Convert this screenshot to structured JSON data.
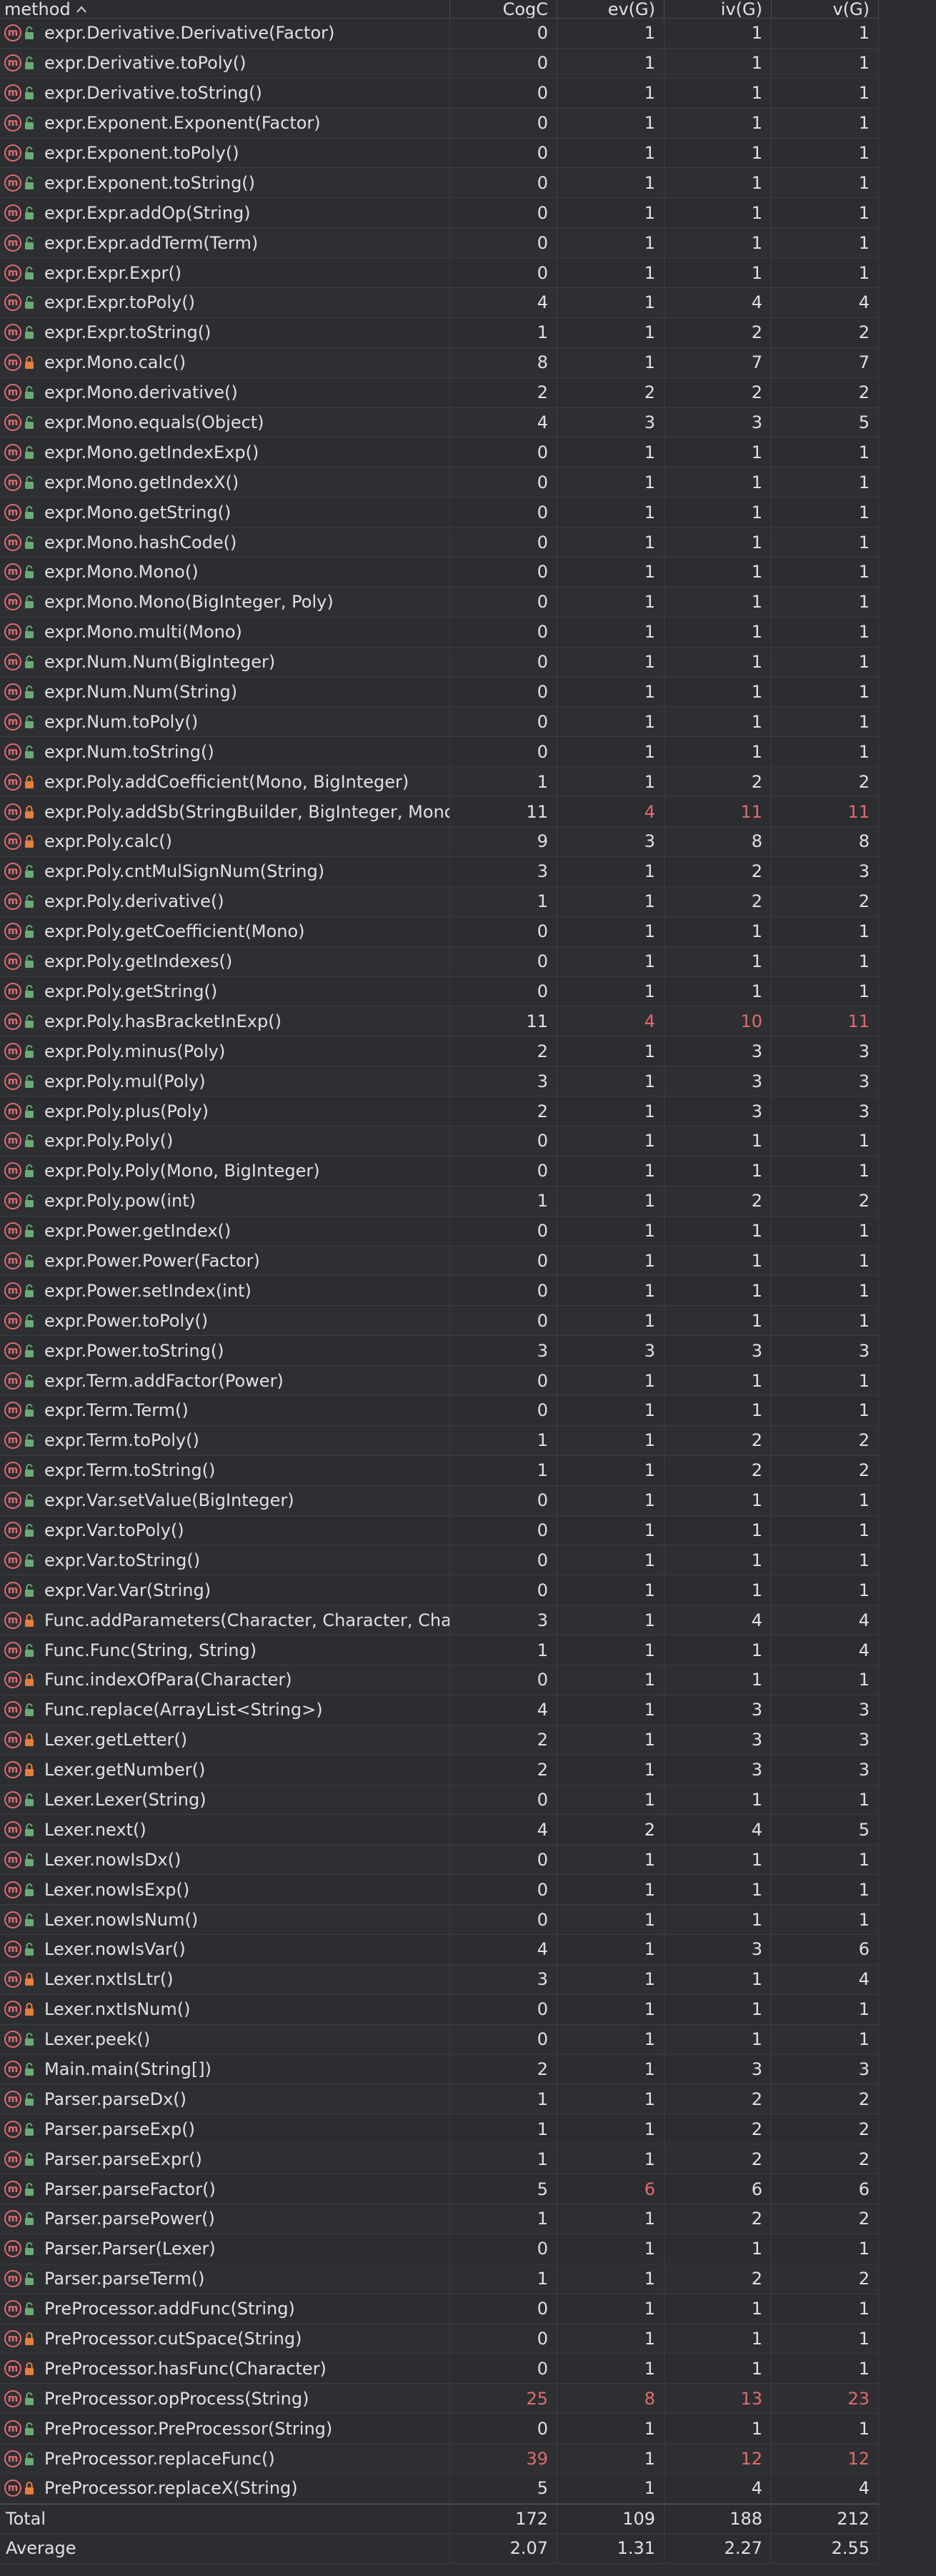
{
  "header": {
    "method": "method",
    "sort_icon": "chevron-up-icon",
    "cogc": "CogC",
    "evg": "ev(G)",
    "ivg": "iv(G)",
    "vg": "v(G)"
  },
  "colors": {
    "background": "#2b2d30",
    "text": "#dfe1e5",
    "warning": "#e06c6c",
    "method_icon": "#e06c75",
    "public_lock": "#6aab73",
    "private_lock": "#e67e3c"
  },
  "rows": [
    {
      "name": "expr.Derivative.Derivative(Factor)",
      "access": "public",
      "cogc": "0",
      "evg": "1",
      "ivg": "1",
      "vg": "1"
    },
    {
      "name": "expr.Derivative.toPoly()",
      "access": "public",
      "cogc": "0",
      "evg": "1",
      "ivg": "1",
      "vg": "1"
    },
    {
      "name": "expr.Derivative.toString()",
      "access": "public",
      "cogc": "0",
      "evg": "1",
      "ivg": "1",
      "vg": "1"
    },
    {
      "name": "expr.Exponent.Exponent(Factor)",
      "access": "public",
      "cogc": "0",
      "evg": "1",
      "ivg": "1",
      "vg": "1"
    },
    {
      "name": "expr.Exponent.toPoly()",
      "access": "public",
      "cogc": "0",
      "evg": "1",
      "ivg": "1",
      "vg": "1"
    },
    {
      "name": "expr.Exponent.toString()",
      "access": "public",
      "cogc": "0",
      "evg": "1",
      "ivg": "1",
      "vg": "1"
    },
    {
      "name": "expr.Expr.addOp(String)",
      "access": "public",
      "cogc": "0",
      "evg": "1",
      "ivg": "1",
      "vg": "1"
    },
    {
      "name": "expr.Expr.addTerm(Term)",
      "access": "public",
      "cogc": "0",
      "evg": "1",
      "ivg": "1",
      "vg": "1"
    },
    {
      "name": "expr.Expr.Expr()",
      "access": "public",
      "cogc": "0",
      "evg": "1",
      "ivg": "1",
      "vg": "1"
    },
    {
      "name": "expr.Expr.toPoly()",
      "access": "public",
      "cogc": "4",
      "evg": "1",
      "ivg": "4",
      "vg": "4"
    },
    {
      "name": "expr.Expr.toString()",
      "access": "public",
      "cogc": "1",
      "evg": "1",
      "ivg": "2",
      "vg": "2"
    },
    {
      "name": "expr.Mono.calc()",
      "access": "private",
      "cogc": "8",
      "evg": "1",
      "ivg": "7",
      "vg": "7"
    },
    {
      "name": "expr.Mono.derivative()",
      "access": "public",
      "cogc": "2",
      "evg": "2",
      "ivg": "2",
      "vg": "2"
    },
    {
      "name": "expr.Mono.equals(Object)",
      "access": "public",
      "cogc": "4",
      "evg": "3",
      "ivg": "3",
      "vg": "5"
    },
    {
      "name": "expr.Mono.getIndexExp()",
      "access": "public",
      "cogc": "0",
      "evg": "1",
      "ivg": "1",
      "vg": "1"
    },
    {
      "name": "expr.Mono.getIndexX()",
      "access": "public",
      "cogc": "0",
      "evg": "1",
      "ivg": "1",
      "vg": "1"
    },
    {
      "name": "expr.Mono.getString()",
      "access": "public",
      "cogc": "0",
      "evg": "1",
      "ivg": "1",
      "vg": "1"
    },
    {
      "name": "expr.Mono.hashCode()",
      "access": "public",
      "cogc": "0",
      "evg": "1",
      "ivg": "1",
      "vg": "1"
    },
    {
      "name": "expr.Mono.Mono()",
      "access": "public",
      "cogc": "0",
      "evg": "1",
      "ivg": "1",
      "vg": "1"
    },
    {
      "name": "expr.Mono.Mono(BigInteger, Poly)",
      "access": "public",
      "cogc": "0",
      "evg": "1",
      "ivg": "1",
      "vg": "1"
    },
    {
      "name": "expr.Mono.multi(Mono)",
      "access": "public",
      "cogc": "0",
      "evg": "1",
      "ivg": "1",
      "vg": "1"
    },
    {
      "name": "expr.Num.Num(BigInteger)",
      "access": "public",
      "cogc": "0",
      "evg": "1",
      "ivg": "1",
      "vg": "1"
    },
    {
      "name": "expr.Num.Num(String)",
      "access": "public",
      "cogc": "0",
      "evg": "1",
      "ivg": "1",
      "vg": "1"
    },
    {
      "name": "expr.Num.toPoly()",
      "access": "public",
      "cogc": "0",
      "evg": "1",
      "ivg": "1",
      "vg": "1"
    },
    {
      "name": "expr.Num.toString()",
      "access": "public",
      "cogc": "0",
      "evg": "1",
      "ivg": "1",
      "vg": "1"
    },
    {
      "name": "expr.Poly.addCoefficient(Mono, BigInteger)",
      "access": "private",
      "cogc": "1",
      "evg": "1",
      "ivg": "2",
      "vg": "2"
    },
    {
      "name": "expr.Poly.addSb(StringBuilder, BigInteger, Mono",
      "access": "private",
      "cogc": "11",
      "evg": "4",
      "ivg": "11",
      "vg": "11",
      "warn": [
        "evg",
        "ivg",
        "vg"
      ]
    },
    {
      "name": "expr.Poly.calc()",
      "access": "private",
      "cogc": "9",
      "evg": "3",
      "ivg": "8",
      "vg": "8"
    },
    {
      "name": "expr.Poly.cntMulSignNum(String)",
      "access": "public",
      "cogc": "3",
      "evg": "1",
      "ivg": "2",
      "vg": "3"
    },
    {
      "name": "expr.Poly.derivative()",
      "access": "public",
      "cogc": "1",
      "evg": "1",
      "ivg": "2",
      "vg": "2"
    },
    {
      "name": "expr.Poly.getCoefficient(Mono)",
      "access": "public",
      "cogc": "0",
      "evg": "1",
      "ivg": "1",
      "vg": "1"
    },
    {
      "name": "expr.Poly.getIndexes()",
      "access": "public",
      "cogc": "0",
      "evg": "1",
      "ivg": "1",
      "vg": "1"
    },
    {
      "name": "expr.Poly.getString()",
      "access": "public",
      "cogc": "0",
      "evg": "1",
      "ivg": "1",
      "vg": "1"
    },
    {
      "name": "expr.Poly.hasBracketInExp()",
      "access": "public",
      "cogc": "11",
      "evg": "4",
      "ivg": "10",
      "vg": "11",
      "warn": [
        "evg",
        "ivg",
        "vg"
      ]
    },
    {
      "name": "expr.Poly.minus(Poly)",
      "access": "public",
      "cogc": "2",
      "evg": "1",
      "ivg": "3",
      "vg": "3"
    },
    {
      "name": "expr.Poly.mul(Poly)",
      "access": "public",
      "cogc": "3",
      "evg": "1",
      "ivg": "3",
      "vg": "3"
    },
    {
      "name": "expr.Poly.plus(Poly)",
      "access": "public",
      "cogc": "2",
      "evg": "1",
      "ivg": "3",
      "vg": "3"
    },
    {
      "name": "expr.Poly.Poly()",
      "access": "public",
      "cogc": "0",
      "evg": "1",
      "ivg": "1",
      "vg": "1"
    },
    {
      "name": "expr.Poly.Poly(Mono, BigInteger)",
      "access": "public",
      "cogc": "0",
      "evg": "1",
      "ivg": "1",
      "vg": "1"
    },
    {
      "name": "expr.Poly.pow(int)",
      "access": "public",
      "cogc": "1",
      "evg": "1",
      "ivg": "2",
      "vg": "2"
    },
    {
      "name": "expr.Power.getIndex()",
      "access": "public",
      "cogc": "0",
      "evg": "1",
      "ivg": "1",
      "vg": "1"
    },
    {
      "name": "expr.Power.Power(Factor)",
      "access": "public",
      "cogc": "0",
      "evg": "1",
      "ivg": "1",
      "vg": "1"
    },
    {
      "name": "expr.Power.setIndex(int)",
      "access": "public",
      "cogc": "0",
      "evg": "1",
      "ivg": "1",
      "vg": "1"
    },
    {
      "name": "expr.Power.toPoly()",
      "access": "public",
      "cogc": "0",
      "evg": "1",
      "ivg": "1",
      "vg": "1"
    },
    {
      "name": "expr.Power.toString()",
      "access": "public",
      "cogc": "3",
      "evg": "3",
      "ivg": "3",
      "vg": "3"
    },
    {
      "name": "expr.Term.addFactor(Power)",
      "access": "public",
      "cogc": "0",
      "evg": "1",
      "ivg": "1",
      "vg": "1"
    },
    {
      "name": "expr.Term.Term()",
      "access": "public",
      "cogc": "0",
      "evg": "1",
      "ivg": "1",
      "vg": "1"
    },
    {
      "name": "expr.Term.toPoly()",
      "access": "public",
      "cogc": "1",
      "evg": "1",
      "ivg": "2",
      "vg": "2"
    },
    {
      "name": "expr.Term.toString()",
      "access": "public",
      "cogc": "1",
      "evg": "1",
      "ivg": "2",
      "vg": "2"
    },
    {
      "name": "expr.Var.setValue(BigInteger)",
      "access": "public",
      "cogc": "0",
      "evg": "1",
      "ivg": "1",
      "vg": "1"
    },
    {
      "name": "expr.Var.toPoly()",
      "access": "public",
      "cogc": "0",
      "evg": "1",
      "ivg": "1",
      "vg": "1"
    },
    {
      "name": "expr.Var.toString()",
      "access": "public",
      "cogc": "0",
      "evg": "1",
      "ivg": "1",
      "vg": "1"
    },
    {
      "name": "expr.Var.Var(String)",
      "access": "public",
      "cogc": "0",
      "evg": "1",
      "ivg": "1",
      "vg": "1"
    },
    {
      "name": "Func.addParameters(Character, Character, Char",
      "access": "private",
      "cogc": "3",
      "evg": "1",
      "ivg": "4",
      "vg": "4"
    },
    {
      "name": "Func.Func(String, String)",
      "access": "public",
      "cogc": "1",
      "evg": "1",
      "ivg": "1",
      "vg": "4"
    },
    {
      "name": "Func.indexOfPara(Character)",
      "access": "private",
      "cogc": "0",
      "evg": "1",
      "ivg": "1",
      "vg": "1"
    },
    {
      "name": "Func.replace(ArrayList<String>)",
      "access": "public",
      "cogc": "4",
      "evg": "1",
      "ivg": "3",
      "vg": "3"
    },
    {
      "name": "Lexer.getLetter()",
      "access": "private",
      "cogc": "2",
      "evg": "1",
      "ivg": "3",
      "vg": "3"
    },
    {
      "name": "Lexer.getNumber()",
      "access": "private",
      "cogc": "2",
      "evg": "1",
      "ivg": "3",
      "vg": "3"
    },
    {
      "name": "Lexer.Lexer(String)",
      "access": "public",
      "cogc": "0",
      "evg": "1",
      "ivg": "1",
      "vg": "1"
    },
    {
      "name": "Lexer.next()",
      "access": "public",
      "cogc": "4",
      "evg": "2",
      "ivg": "4",
      "vg": "5"
    },
    {
      "name": "Lexer.nowIsDx()",
      "access": "public",
      "cogc": "0",
      "evg": "1",
      "ivg": "1",
      "vg": "1"
    },
    {
      "name": "Lexer.nowIsExp()",
      "access": "public",
      "cogc": "0",
      "evg": "1",
      "ivg": "1",
      "vg": "1"
    },
    {
      "name": "Lexer.nowIsNum()",
      "access": "public",
      "cogc": "0",
      "evg": "1",
      "ivg": "1",
      "vg": "1"
    },
    {
      "name": "Lexer.nowIsVar()",
      "access": "public",
      "cogc": "4",
      "evg": "1",
      "ivg": "3",
      "vg": "6"
    },
    {
      "name": "Lexer.nxtIsLtr()",
      "access": "private",
      "cogc": "3",
      "evg": "1",
      "ivg": "1",
      "vg": "4"
    },
    {
      "name": "Lexer.nxtIsNum()",
      "access": "private",
      "cogc": "0",
      "evg": "1",
      "ivg": "1",
      "vg": "1"
    },
    {
      "name": "Lexer.peek()",
      "access": "public",
      "cogc": "0",
      "evg": "1",
      "ivg": "1",
      "vg": "1"
    },
    {
      "name": "Main.main(String[])",
      "access": "public",
      "cogc": "2",
      "evg": "1",
      "ivg": "3",
      "vg": "3"
    },
    {
      "name": "Parser.parseDx()",
      "access": "public",
      "cogc": "1",
      "evg": "1",
      "ivg": "2",
      "vg": "2"
    },
    {
      "name": "Parser.parseExp()",
      "access": "public",
      "cogc": "1",
      "evg": "1",
      "ivg": "2",
      "vg": "2"
    },
    {
      "name": "Parser.parseExpr()",
      "access": "public",
      "cogc": "1",
      "evg": "1",
      "ivg": "2",
      "vg": "2"
    },
    {
      "name": "Parser.parseFactor()",
      "access": "public",
      "cogc": "5",
      "evg": "6",
      "ivg": "6",
      "vg": "6",
      "warn": [
        "evg"
      ]
    },
    {
      "name": "Parser.parsePower()",
      "access": "public",
      "cogc": "1",
      "evg": "1",
      "ivg": "2",
      "vg": "2"
    },
    {
      "name": "Parser.Parser(Lexer)",
      "access": "public",
      "cogc": "0",
      "evg": "1",
      "ivg": "1",
      "vg": "1"
    },
    {
      "name": "Parser.parseTerm()",
      "access": "public",
      "cogc": "1",
      "evg": "1",
      "ivg": "2",
      "vg": "2"
    },
    {
      "name": "PreProcessor.addFunc(String)",
      "access": "public",
      "cogc": "0",
      "evg": "1",
      "ivg": "1",
      "vg": "1"
    },
    {
      "name": "PreProcessor.cutSpace(String)",
      "access": "private",
      "cogc": "0",
      "evg": "1",
      "ivg": "1",
      "vg": "1"
    },
    {
      "name": "PreProcessor.hasFunc(Character)",
      "access": "private",
      "cogc": "0",
      "evg": "1",
      "ivg": "1",
      "vg": "1"
    },
    {
      "name": "PreProcessor.opProcess(String)",
      "access": "public",
      "cogc": "25",
      "evg": "8",
      "ivg": "13",
      "vg": "23",
      "warn": [
        "cogc",
        "evg",
        "ivg",
        "vg"
      ]
    },
    {
      "name": "PreProcessor.PreProcessor(String)",
      "access": "public",
      "cogc": "0",
      "evg": "1",
      "ivg": "1",
      "vg": "1"
    },
    {
      "name": "PreProcessor.replaceFunc()",
      "access": "public",
      "cogc": "39",
      "evg": "1",
      "ivg": "12",
      "vg": "12",
      "warn": [
        "cogc",
        "ivg",
        "vg"
      ]
    },
    {
      "name": "PreProcessor.replaceX(String)",
      "access": "private",
      "cogc": "5",
      "evg": "1",
      "ivg": "4",
      "vg": "4"
    }
  ],
  "total": {
    "label": "Total",
    "cogc": "172",
    "evg": "109",
    "ivg": "188",
    "vg": "212"
  },
  "average": {
    "label": "Average",
    "cogc": "2.07",
    "evg": "1.31",
    "ivg": "2.27",
    "vg": "2.55"
  }
}
